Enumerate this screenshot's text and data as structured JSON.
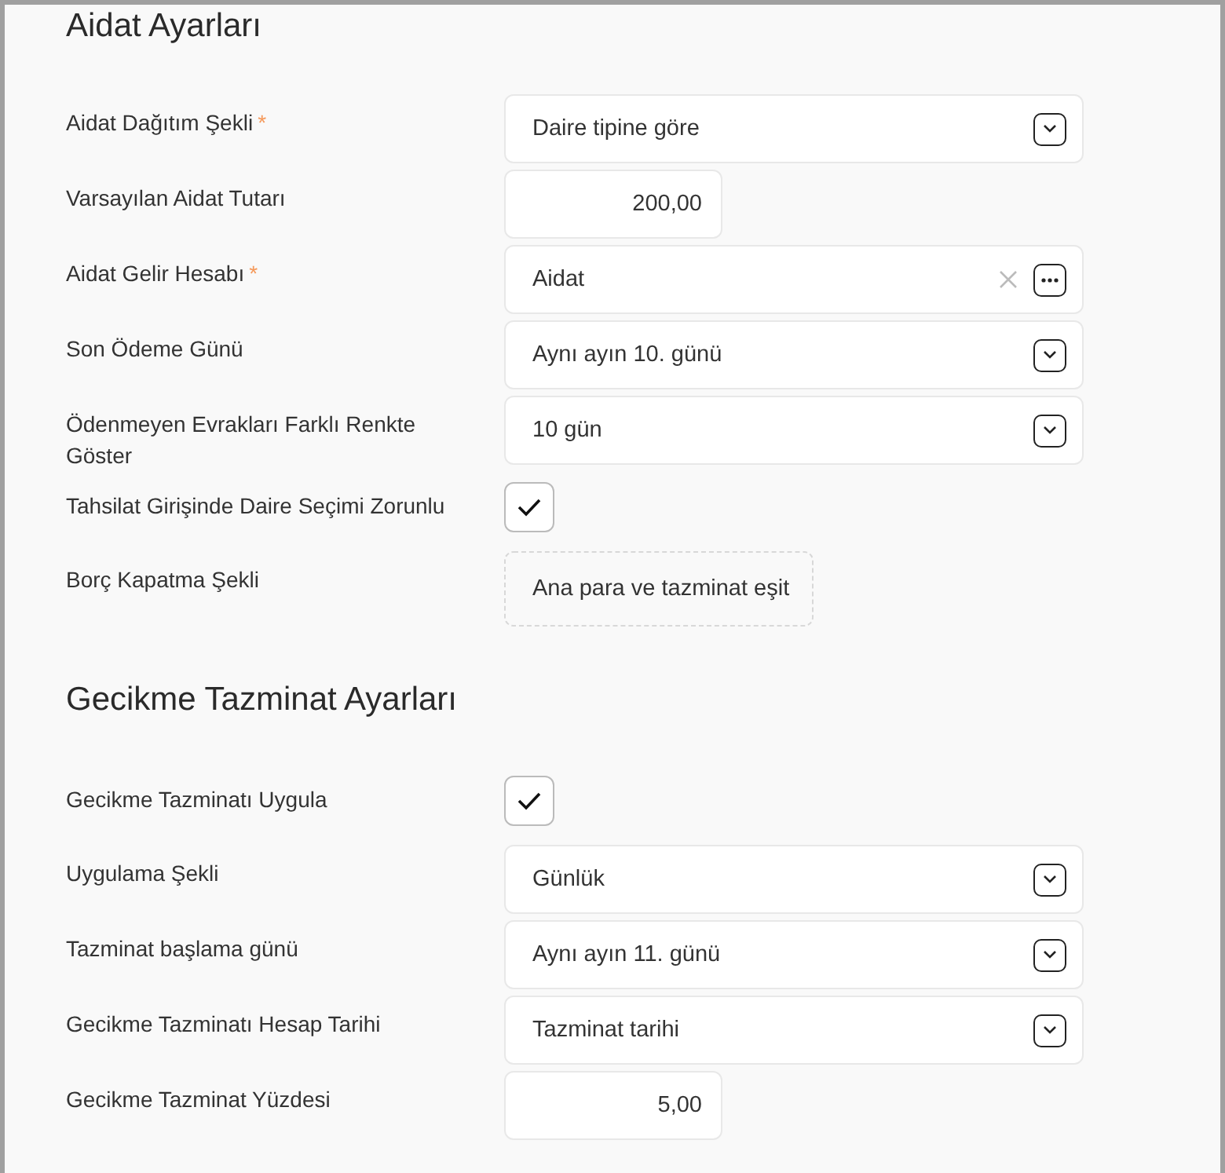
{
  "sections": [
    {
      "title": "Aidat Ayarları",
      "fields": [
        {
          "label": "Aidat Dağıtım Şekli",
          "required_mark": "*",
          "kind": "select",
          "value": "Daire tipine göre"
        },
        {
          "label": "Varsayılan Aidat Tutarı",
          "kind": "number",
          "value": "200,00"
        },
        {
          "label": "Aidat Gelir Hesabı",
          "required_mark": "*",
          "kind": "lookup",
          "value": "Aidat"
        },
        {
          "label": "Son Ödeme Günü",
          "kind": "select",
          "value": "Aynı ayın 10. günü"
        },
        {
          "label": "Ödenmeyen Evrakları Farklı Renkte Göster",
          "kind": "select",
          "value": "10 gün"
        },
        {
          "label": "Tahsilat Girişinde Daire Seçimi Zorunlu",
          "kind": "checkbox",
          "checked": true
        },
        {
          "label": "Borç Kapatma Şekli",
          "kind": "static",
          "value": "Ana para ve tazminat eşit"
        }
      ]
    },
    {
      "title": "Gecikme Tazminat Ayarları",
      "fields": [
        {
          "label": "Gecikme Tazminatı Uygula",
          "kind": "checkbox",
          "checked": true
        },
        {
          "label": "Uygulama Şekli",
          "kind": "select",
          "value": "Günlük"
        },
        {
          "label": "Tazminat başlama günü",
          "kind": "select",
          "value": "Aynı ayın 11. günü"
        },
        {
          "label": "Gecikme Tazminatı Hesap Tarihi",
          "kind": "select",
          "value": "Tazminat tarihi"
        },
        {
          "label": "Gecikme Tazminat Yüzdesi",
          "kind": "number",
          "value": "5,00"
        }
      ]
    }
  ]
}
